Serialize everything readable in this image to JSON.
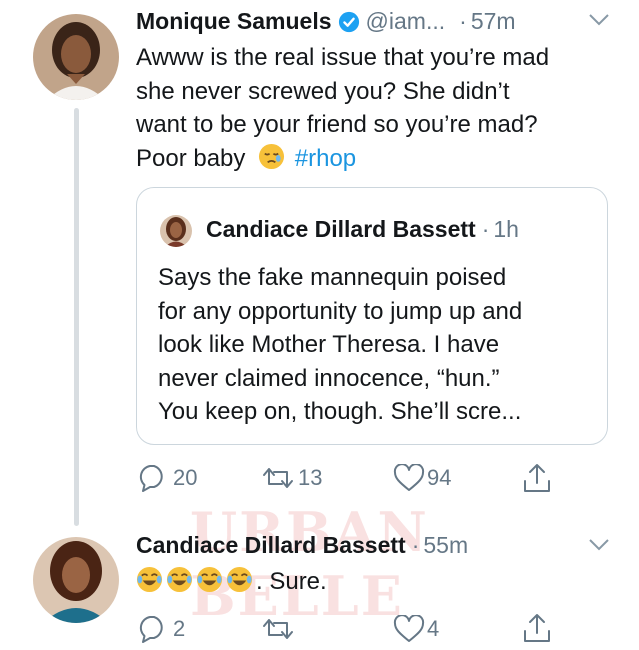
{
  "tweet1": {
    "name": "Monique Samuels",
    "handle": "@iam...",
    "dot": "·",
    "time": "57m",
    "lines": [
      "Awww is the real issue that you’re mad",
      "she never screwed you? She didn’t",
      "want to be your friend so you’re mad?"
    ],
    "last_line_text": "Poor baby",
    "hashtag": "#rhop",
    "emoji": "sleepy-face",
    "quote": {
      "name": "Candiace Dillard Bassett",
      "dot": "·",
      "time": "1h",
      "lines": [
        "Says the fake mannequin poised",
        "for any opportunity to jump up and",
        "look like Mother Theresa. I have",
        "never claimed innocence, “hun.”",
        "You keep on, though. She’ll scre..."
      ]
    },
    "actions": {
      "replies": "20",
      "retweets": "13",
      "likes": "94"
    }
  },
  "tweet2": {
    "name": "Candiace Dillard Bassett",
    "dot": "·",
    "time": "55m",
    "emojis": [
      "face-with-tears-of-joy",
      "face-with-tears-of-joy",
      "face-with-tears-of-joy",
      "face-with-tears-of-joy"
    ],
    "text": ". Sure.",
    "actions": {
      "replies": "2",
      "retweets": "",
      "likes": "4"
    }
  },
  "watermark": "URBAN BELLE",
  "colors": {
    "link": "#1b95e0",
    "verified": "#1da1f2",
    "meta": "#657786",
    "border": "#ccd6dd"
  }
}
